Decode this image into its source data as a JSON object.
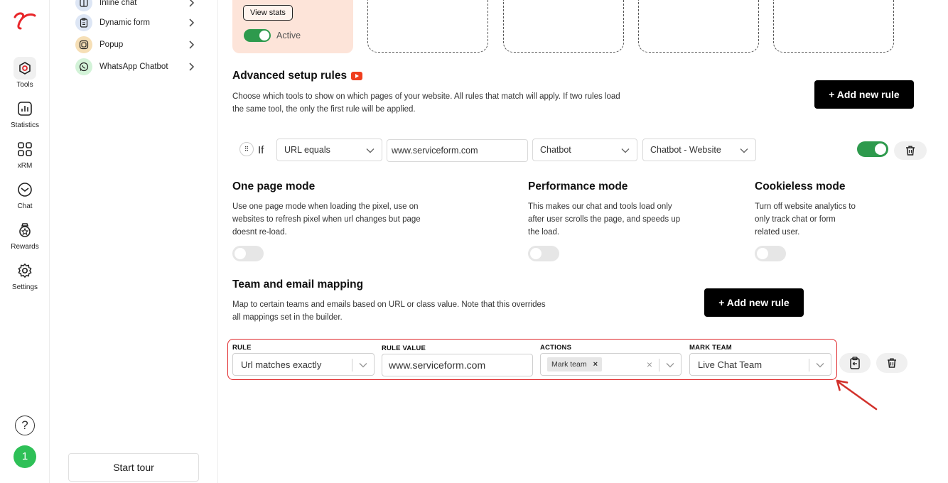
{
  "rail": {
    "items": [
      {
        "label": "Tools",
        "icon": "tools-icon",
        "active": true
      },
      {
        "label": "Statistics",
        "icon": "statistics-icon"
      },
      {
        "label": "xRM",
        "icon": "grid-icon"
      },
      {
        "label": "Chat",
        "icon": "chat-icon"
      },
      {
        "label": "Rewards",
        "icon": "rewards-icon"
      },
      {
        "label": "Settings",
        "icon": "gear-icon"
      }
    ],
    "help": "?",
    "avatar": "1"
  },
  "sidebar": {
    "items": [
      {
        "label": "Inline chat",
        "icon": "inline-chat-icon"
      },
      {
        "label": "Dynamic form",
        "icon": "form-icon"
      },
      {
        "label": "Popup",
        "icon": "popup-icon"
      },
      {
        "label": "WhatsApp Chatbot",
        "icon": "whatsapp-icon"
      }
    ],
    "start_tour": "Start tour"
  },
  "top_card": {
    "view_stats": "View stats",
    "status_label": "Active",
    "status_on": true
  },
  "advanced": {
    "title": "Advanced setup rules",
    "description_1": "Choose which tools to show on which pages of your website. All rules that match will apply. If two rules load",
    "description_2": "the same tool, the only the first rule will be applied.",
    "add_rule": "+ Add new rule",
    "rule": {
      "drag": "⠿",
      "if_label": "If",
      "condition": "URL equals",
      "url_value": "www.serviceform.com",
      "tool_type": "Chatbot",
      "tool_name": "Chatbot - Website",
      "enabled": true
    }
  },
  "modes": [
    {
      "title": "One page mode",
      "lines": [
        "Use one page mode when loading the pixel, use on",
        "websites to refresh pixel when url changes but page",
        "doesnt re-load."
      ],
      "on": false
    },
    {
      "title": "Performance mode",
      "lines": [
        "This makes our chat and tools load only",
        "after user scrolls the page, and speeds up",
        "the load."
      ],
      "on": false
    },
    {
      "title": "Cookieless mode",
      "lines": [
        "Turn off website analytics to",
        "only track chat or form",
        "related user."
      ],
      "on": false
    }
  ],
  "mapping": {
    "title": "Team and email mapping",
    "description_1": "Map to certain teams and emails based on URL or class value. Note that this overrides",
    "description_2": "all mappings set in the builder.",
    "add_rule": "+ Add new rule",
    "row": {
      "rule_label": "RULE",
      "rule_value_sel": "Url matches exactly",
      "value_label": "RULE VALUE",
      "value": "www.serviceform.com",
      "actions_label": "ACTIONS",
      "action_chip": "Mark team",
      "chip_remove": "×",
      "clear": "×",
      "team_label": "MARK TEAM",
      "team": "Live Chat Team"
    }
  },
  "colors": {
    "accent_green": "#2e9a4d",
    "highlight_red": "#e0272a",
    "card_pink": "#fde4d9",
    "logo_red": "#e8262a"
  }
}
